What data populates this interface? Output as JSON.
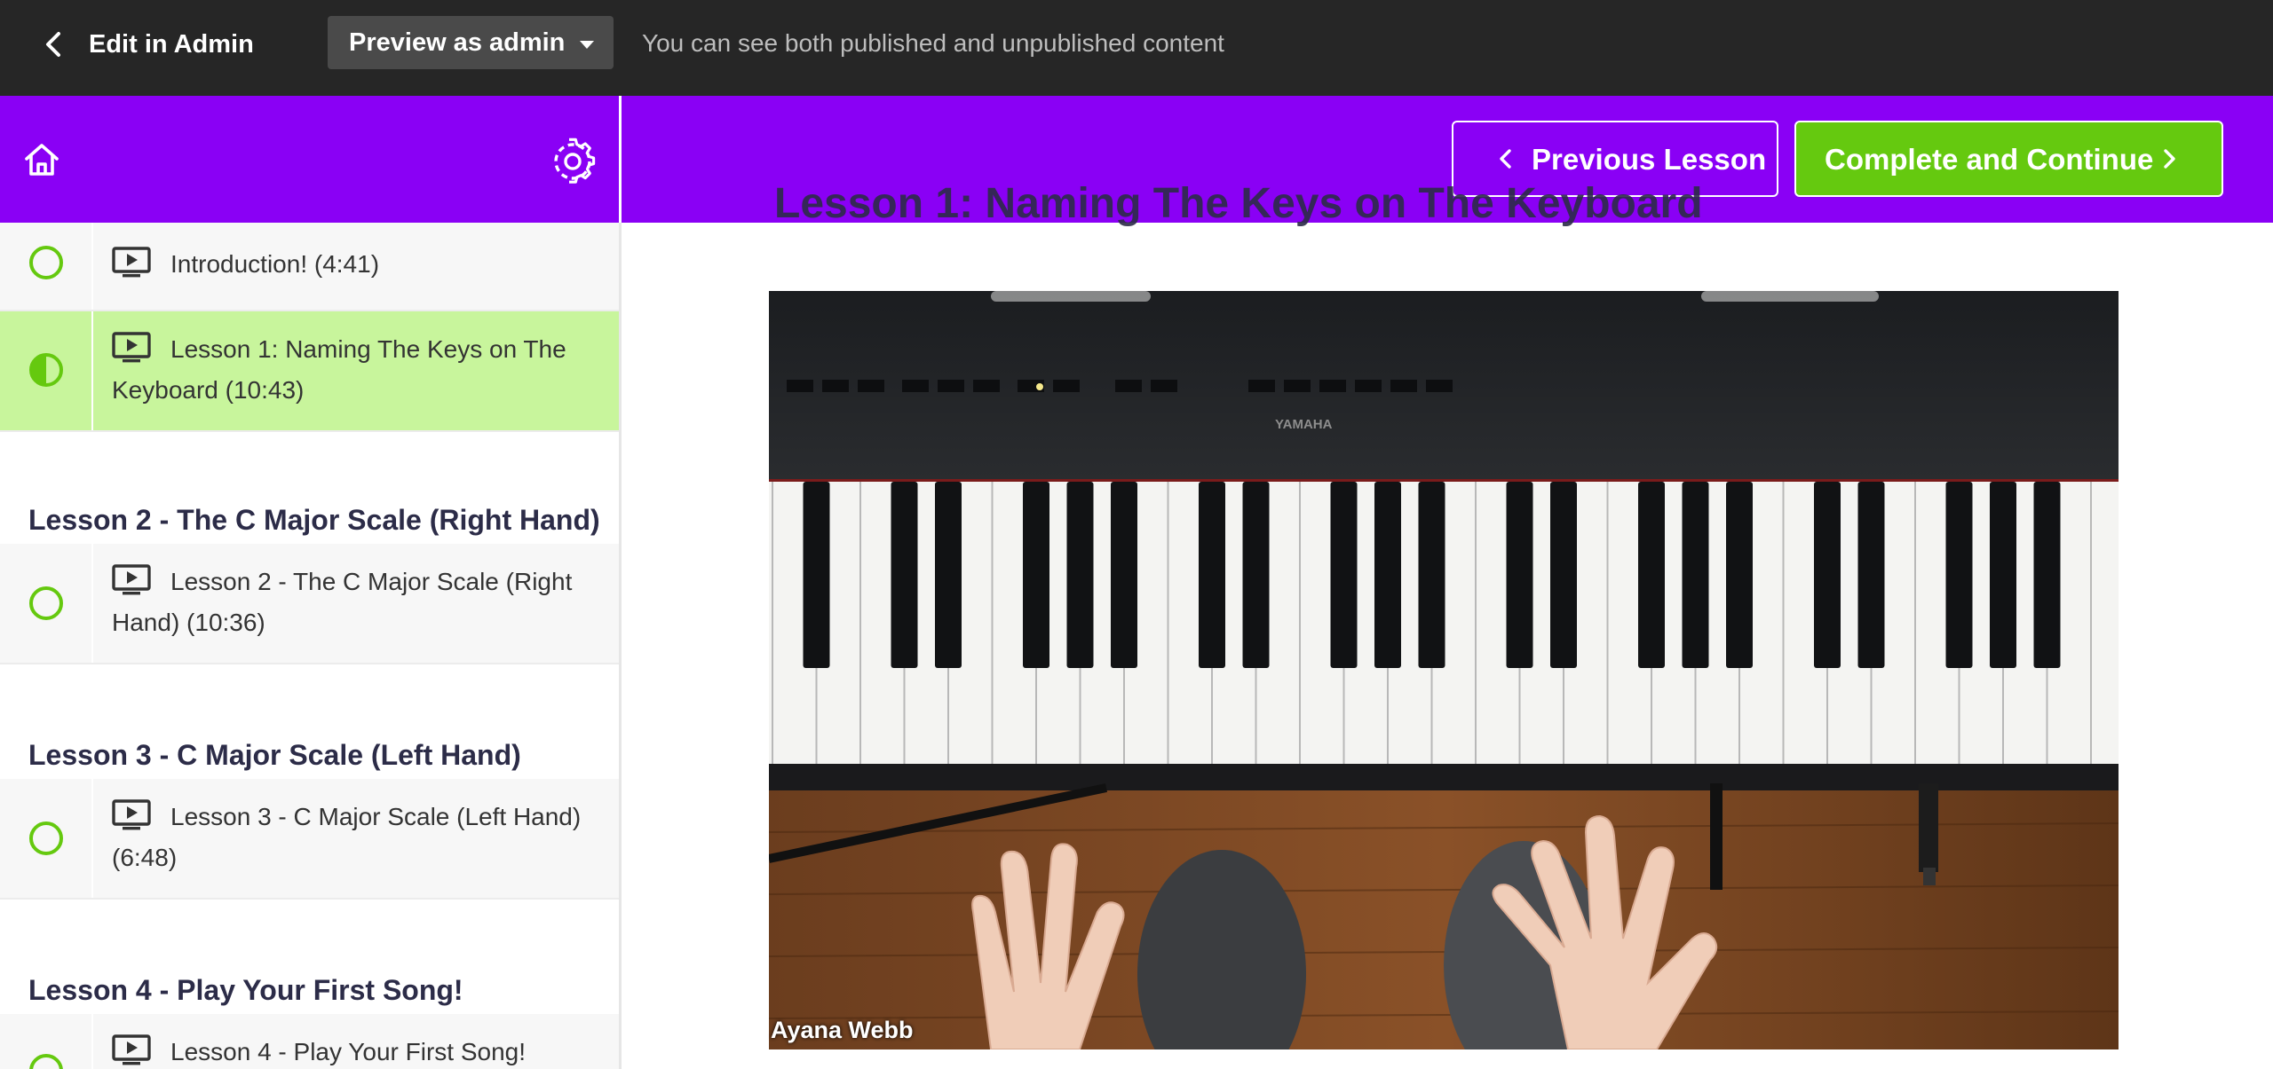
{
  "admin_bar": {
    "edit_label": "Edit in Admin",
    "preview_label": "Preview as admin",
    "note": "You can see both published and unpublished content"
  },
  "header": {
    "home_icon": "home-icon",
    "settings_icon": "gear-icon",
    "prev_label": "Previous Lesson",
    "next_label": "Complete and Continue",
    "colors": {
      "header_bg": "#8a00f5",
      "complete_button": "#65c90f"
    }
  },
  "sidebar": {
    "items": [
      {
        "type": "lesson",
        "title": "Introduction! (4:41)",
        "status": "not-started"
      },
      {
        "type": "lesson",
        "title": "Lesson 1: Naming The Keys on The Keyboard (10:43)",
        "status": "in-progress"
      },
      {
        "type": "section",
        "title": "Lesson 2 - The C Major Scale (Right Hand)"
      },
      {
        "type": "lesson",
        "title": "Lesson 2 - The C Major Scale (Right Hand) (10:36)",
        "status": "not-started"
      },
      {
        "type": "section",
        "title": "Lesson 3 - C Major Scale (Left Hand)"
      },
      {
        "type": "lesson",
        "title": "Lesson 3 - C Major Scale (Left Hand) (6:48)",
        "status": "not-started"
      },
      {
        "type": "section",
        "title": "Lesson 4 - Play Your First Song!"
      },
      {
        "type": "lesson",
        "title": "Lesson 4 - Play Your First Song!",
        "status": "not-started"
      }
    ],
    "colors": {
      "active_row": "#c8f59c",
      "status_ring": "#65c90f"
    }
  },
  "main": {
    "lesson_title": "Lesson 1: Naming The Keys on The Keyboard",
    "video": {
      "brand_text": "YAMAHA",
      "caption": "Ayana Webb"
    }
  }
}
